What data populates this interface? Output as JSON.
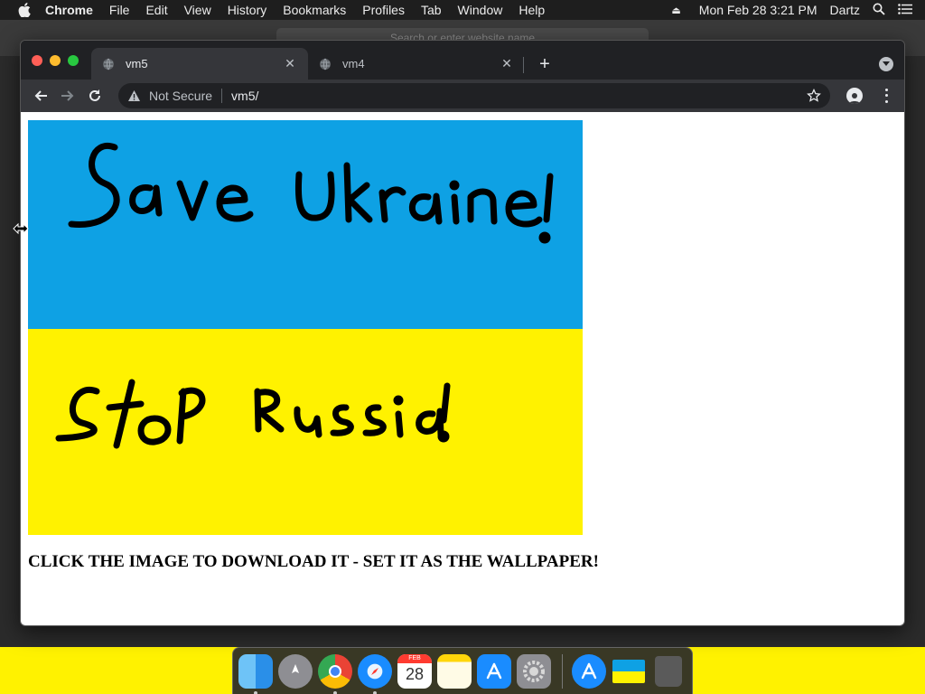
{
  "menubar": {
    "items": [
      "Chrome",
      "File",
      "Edit",
      "View",
      "History",
      "Bookmarks",
      "Profiles",
      "Tab",
      "Window",
      "Help"
    ],
    "clock": "Mon Feb 28  3:21 PM",
    "user": "Dartz"
  },
  "background_window": {
    "search_placeholder": "Search or enter website name"
  },
  "browser": {
    "tabs": [
      {
        "title": "vm5",
        "active": true
      },
      {
        "title": "vm4",
        "active": false
      }
    ],
    "address": {
      "security_label": "Not Secure",
      "url": "vm5/"
    }
  },
  "page": {
    "image_text_top": "Save Ukraine!",
    "image_text_bottom": "Stop Russia!",
    "caption": "CLICK THE IMAGE TO DOWNLOAD IT - SET IT AS THE WALLPAPER!",
    "colors": {
      "flag_blue": "#0ea1e4",
      "flag_yellow": "#fff200"
    }
  },
  "dock": {
    "calendar_month": "FEB",
    "calendar_day": "28",
    "items": [
      "finder-icon",
      "launchpad-icon",
      "chrome-icon",
      "safari-icon",
      "calendar-icon",
      "notes-icon",
      "app-store-icon",
      "system-preferences-icon",
      "app-store-download-icon",
      "downloaded-image-icon",
      "trash-icon"
    ]
  }
}
